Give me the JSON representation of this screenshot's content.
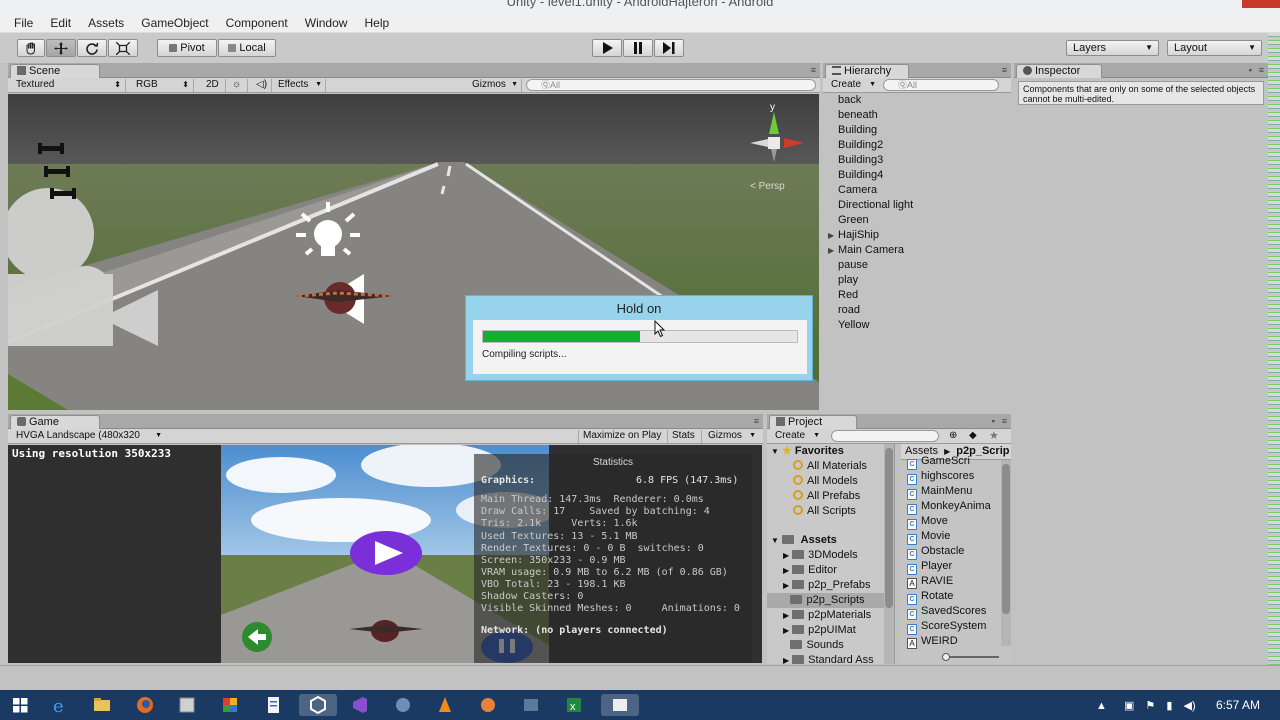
{
  "window": {
    "title": "Unity - level1.unity - AndroidHajteron - Android"
  },
  "menu": [
    "File",
    "Edit",
    "Assets",
    "GameObject",
    "Component",
    "Window",
    "Help"
  ],
  "toolbar": {
    "pivot": "Pivot",
    "local": "Local",
    "layers": "Layers",
    "layout": "Layout"
  },
  "scene": {
    "tab": "Scene",
    "shading": "Textured",
    "render": "RGB",
    "mode2d": "2D",
    "effects": "Effects",
    "gizmos": "Gizmos",
    "search": "ⓆAll",
    "persp": "< Persp",
    "axis_y": "y"
  },
  "hierarchy": {
    "tab": "Hierarchy",
    "create": "Create",
    "search": "ⓆAll",
    "items": [
      {
        "label": "back",
        "expandable": false
      },
      {
        "label": "beneath",
        "expandable": false
      },
      {
        "label": "Building",
        "expandable": false
      },
      {
        "label": "Building2",
        "expandable": false
      },
      {
        "label": "Building3",
        "expandable": false
      },
      {
        "label": "Building4",
        "expandable": false
      },
      {
        "label": "Camera",
        "expandable": false
      },
      {
        "label": "Directional light",
        "expandable": false
      },
      {
        "label": "Green",
        "expandable": false
      },
      {
        "label": "HajiShip",
        "expandable": true
      },
      {
        "label": "Main Camera",
        "expandable": true
      },
      {
        "label": "pause",
        "expandable": false
      },
      {
        "label": "play",
        "expandable": false
      },
      {
        "label": "Red",
        "expandable": false
      },
      {
        "label": "road",
        "expandable": false
      },
      {
        "label": "Yellow",
        "expandable": false
      }
    ]
  },
  "inspector": {
    "tab": "Inspector",
    "note": "Components that are only on some of the selected objects cannot be multi-edited."
  },
  "dialog": {
    "title": "Hold on",
    "message": "Compiling scripts...",
    "progress": 0.5
  },
  "game": {
    "tab": "Game",
    "aspect": "HVGA Landscape (480x320",
    "maximize": "Maximize on Play",
    "stats": "Stats",
    "gizmos": "Gizmos",
    "resolution": "Using resolution 350x233"
  },
  "stats": {
    "title": "Statistics",
    "graphics": "Graphics:",
    "fps": "6.8 FPS (147.3ms)",
    "lines": [
      "Main Thread: 147.3ms  Renderer: 0.0ms",
      "Draw Calls: 17    Saved by batching: 4",
      "Tris: 2.1k     Verts: 1.6k",
      "Used Textures: 13 - 5.1 MB",
      "Render Textures: 0 - 0 B  switches: 0",
      "Screen: 350x233 - 0.9 MB",
      "VRAM usage: 0.9 MB to 6.2 MB (of 0.86 GB)",
      "VBO Total: 23 - 198.1 KB",
      "Shadow Casters: 0",
      "Visible Skinned Meshes: 0     Animations: 0"
    ],
    "network": "Network: (no players connected)"
  },
  "project": {
    "tab": "Project",
    "create": "Create",
    "favorites_label": "Favorites",
    "favorites": [
      "All Materials",
      "All Models",
      "All Prefabs",
      "All Scripts"
    ],
    "assets_label": "Assets",
    "folders": [
      "3DModels",
      "Editor",
      "p2p_Prefabs",
      "p2p_Scripts",
      "p2pMaterials",
      "p2pUIMat",
      "Sounds",
      "Standard Ass"
    ],
    "selected_folder": "p2p_Scripts",
    "breadcrumb_root": "Assets",
    "breadcrumb_leaf": "p2p_Scrip",
    "files": [
      {
        "name": "GameScri",
        "kind": "script"
      },
      {
        "name": "highscores",
        "kind": "script"
      },
      {
        "name": "MainMenu",
        "kind": "script"
      },
      {
        "name": "MonkeyAnima",
        "kind": "script"
      },
      {
        "name": "Move",
        "kind": "script"
      },
      {
        "name": "Movie",
        "kind": "script"
      },
      {
        "name": "Obstacle",
        "kind": "script"
      },
      {
        "name": "Player",
        "kind": "script"
      },
      {
        "name": "RAVIE",
        "kind": "font"
      },
      {
        "name": "Rotate",
        "kind": "script"
      },
      {
        "name": "SavedScores",
        "kind": "script"
      },
      {
        "name": "ScoreSystem",
        "kind": "script"
      },
      {
        "name": "WEIRD",
        "kind": "font"
      }
    ]
  },
  "taskbar": {
    "time": "6:57 AM"
  },
  "colors": {
    "progress_fill": "#12b02d",
    "dialog_frame": "#97d3ea",
    "taskbar": "#1b3a63",
    "title_close": "#c7392b"
  }
}
